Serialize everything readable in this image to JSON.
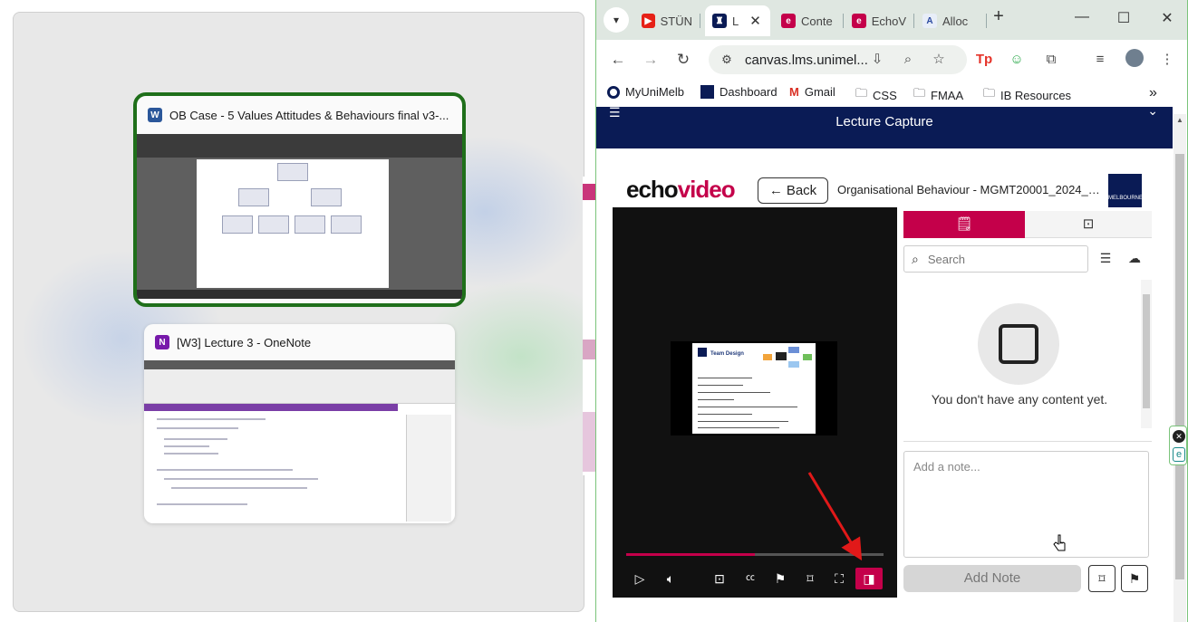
{
  "snap": {
    "cards": [
      {
        "app": "Word",
        "title": "OB Case - 5 Values Attitudes & Behaviours final v3-..."
      },
      {
        "app": "OneNote",
        "title": "[W3] Lecture 3 - OneNote"
      }
    ]
  },
  "browser": {
    "tabs": [
      {
        "label": "STÜN",
        "icon": "youtube-icon"
      },
      {
        "label": "L",
        "icon": "unimelb-icon",
        "active": true
      },
      {
        "label": "Conte",
        "icon": "echo-icon"
      },
      {
        "label": "EchoV",
        "icon": "echo-icon"
      },
      {
        "label": "Alloc",
        "icon": "allocate-icon"
      }
    ],
    "url": "canvas.lms.unimel...",
    "bookmarks": [
      {
        "label": "MyUniMelb",
        "icon": "circle-icon"
      },
      {
        "label": "Dashboard",
        "icon": "unimelb-icon"
      },
      {
        "label": "Gmail",
        "icon": "gmail-icon"
      },
      {
        "label": "CSS",
        "icon": "folder-icon"
      },
      {
        "label": "FMAA",
        "icon": "folder-icon"
      },
      {
        "label": "IB Resources",
        "icon": "folder-icon"
      }
    ],
    "more_bookmarks": "»"
  },
  "page": {
    "header_title": "Lecture Capture",
    "logo_primary": "echo",
    "logo_accent": "video",
    "back_label": "Back",
    "course_title": "Organisational Behaviour - MGMT20001_2024_S...",
    "uni_logo_text": "MELBOURNE",
    "slide_title": "Team Design",
    "playback_progress": 0.5,
    "panel": {
      "search_placeholder": "Search",
      "empty_message": "You don't have any content yet.",
      "note_placeholder": "Add a note...",
      "add_note_label": "Add Note"
    }
  },
  "colors": {
    "echo_accent": "#c4004a",
    "header_navy": "#0a1b55",
    "selected_outline": "#1f6f1a"
  }
}
